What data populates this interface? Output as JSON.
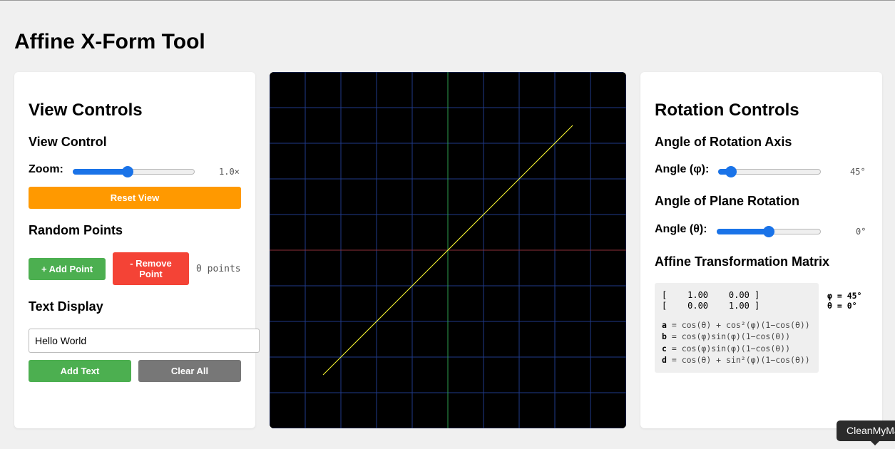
{
  "app": {
    "title": "Affine X-Form Tool"
  },
  "view_controls": {
    "heading": "View Controls",
    "view_control_heading": "View Control",
    "zoom_label": "Zoom:",
    "zoom_value": "1.0×",
    "zoom_fraction": 0.45,
    "reset_label": "Reset View",
    "random_points_heading": "Random Points",
    "add_point_label": "+ Add Point",
    "remove_point_label": "- Remove Point",
    "points_count": "0 points",
    "text_display_heading": "Text Display",
    "text_input_value": "Hello World",
    "add_text_label": "Add Text",
    "clear_all_label": "Clear All"
  },
  "rotation_controls": {
    "heading": "Rotation Controls",
    "axis_heading": "Angle of Rotation Axis",
    "phi_label": "Angle (φ):",
    "phi_value": "45°",
    "phi_fraction": 0.125,
    "plane_heading": "Angle of Plane Rotation",
    "theta_label": "Angle (θ):",
    "theta_value": "0°",
    "theta_fraction": 0.5,
    "matrix_heading": "Affine Transformation Matrix",
    "matrix_row1": "[    1.00    0.00 ]",
    "matrix_row2": "[    0.00    1.00 ]",
    "phi_readout": "φ = 45°",
    "theta_readout": "θ = 0°",
    "formula_a_var": "a",
    "formula_a": " = cos(θ) + cos²(φ)(1−cos(θ))",
    "formula_b_var": "b",
    "formula_b": " = cos(φ)sin(φ)(1−cos(θ))",
    "formula_c_var": "c",
    "formula_c": " = cos(φ)sin(φ)(1−cos(θ))",
    "formula_d_var": "d",
    "formula_d": " = cos(θ) + sin²(φ)(1−cos(θ))"
  },
  "canvas": {
    "background": "#000000",
    "grid_color": "#1f3a8a",
    "x_axis_color": "#8b2f3a",
    "y_axis_color": "#2e9e4e",
    "line_color": "#ffff33",
    "grid_min": -5,
    "grid_max": 5,
    "axis_line": {
      "x1": -3.5,
      "y1": -3.5,
      "x2": 3.5,
      "y2": 3.5
    }
  },
  "tooltip": {
    "text": "CleanMyMac"
  },
  "colors": {
    "accent_blue": "#1a73e8",
    "reset_orange": "#ff9900",
    "add_green": "#4caf50",
    "remove_red": "#f44336",
    "clear_gray": "#777777"
  }
}
